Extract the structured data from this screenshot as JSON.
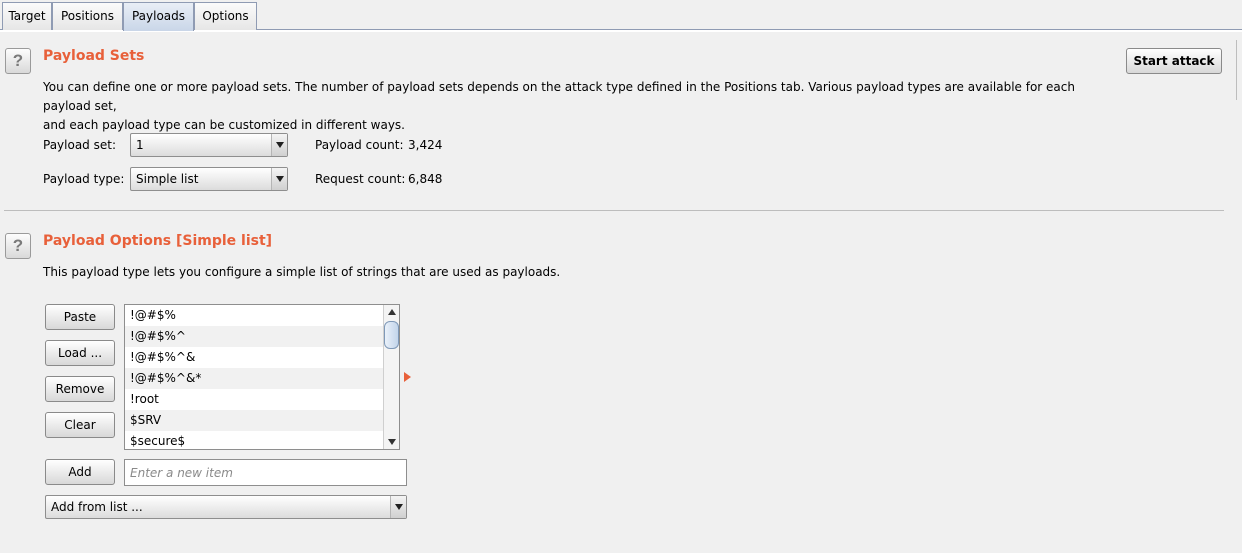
{
  "tabs": [
    {
      "label": "Target"
    },
    {
      "label": "Positions"
    },
    {
      "label": "Payloads"
    },
    {
      "label": "Options"
    }
  ],
  "active_tab": "Payloads",
  "payload_sets": {
    "help_icon": "question-mark",
    "title": "Payload Sets",
    "description_line1": "You can define one or more payload sets. The number of payload sets depends on the attack type defined in the Positions tab. Various payload types are available for each payload set,",
    "description_line2": "and each payload type can be customized in different ways.",
    "payload_set_label": "Payload set:",
    "payload_set_value": "1",
    "payload_type_label": "Payload type:",
    "payload_type_value": "Simple list",
    "payload_count_label": "Payload count:",
    "payload_count_value": "3,424",
    "request_count_label": "Request count:",
    "request_count_value": "6,848",
    "start_attack_label": "Start attack"
  },
  "payload_options": {
    "help_icon": "question-mark",
    "title": "Payload Options [Simple list]",
    "description": "This payload type lets you configure a simple list of strings that are used as payloads.",
    "buttons": {
      "paste": "Paste",
      "load": "Load ...",
      "remove": "Remove",
      "clear": "Clear",
      "add": "Add"
    },
    "list_items": [
      "!@#$%",
      "!@#$%^",
      "!@#$%^&",
      "!@#$%^&*",
      "!root",
      "$SRV",
      "$secure$"
    ],
    "new_item_placeholder": "Enter a new item",
    "add_from_list_value": "Add from list ..."
  },
  "colors": {
    "accent": "#e8603a",
    "background": "#f0f0f0"
  }
}
